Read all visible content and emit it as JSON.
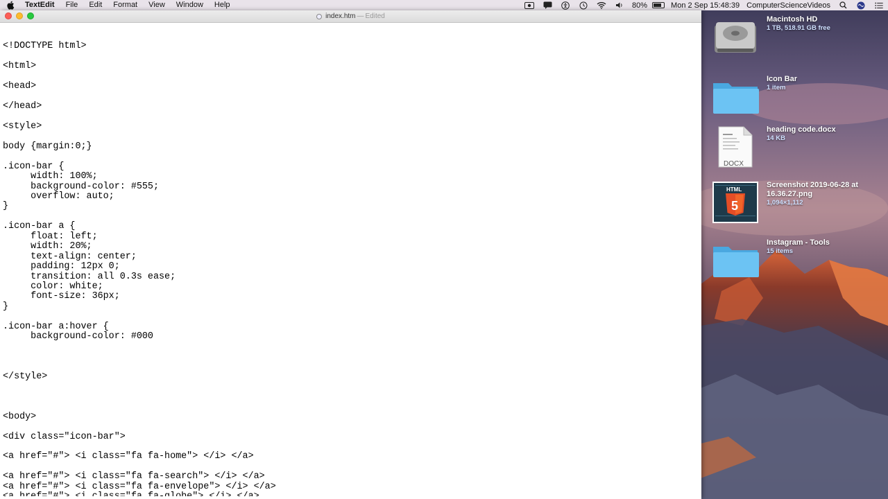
{
  "menubar": {
    "app_name": "TextEdit",
    "menus": [
      "File",
      "Edit",
      "Format",
      "View",
      "Window",
      "Help"
    ],
    "battery_percent": "80%",
    "battery_level": 0.8,
    "datetime": "Mon 2 Sep  15:48:39",
    "user": "ComputerScienceVideos"
  },
  "window": {
    "title": "index.htm",
    "separator": "—",
    "status": "Edited"
  },
  "editor": {
    "lines": [
      "",
      "<!DOCTYPE html>",
      "",
      "<html>",
      "",
      "<head>",
      "",
      "</head>",
      "",
      "<style>",
      "",
      "body {margin:0;}",
      "",
      ".icon-bar {",
      "     width: 100%;",
      "     background-color: #555;",
      "     overflow: auto;",
      "}",
      "",
      ".icon-bar a {",
      "     float: left;",
      "     width: 20%;",
      "     text-align: center;",
      "     padding: 12px 0;",
      "     transition: all 0.3s ease;",
      "     color: white;",
      "     font-size: 36px;",
      "}",
      "",
      ".icon-bar a:hover {",
      "     background-color: #000",
      "",
      "",
      "",
      "</style>",
      "",
      "",
      "",
      "<body>",
      "",
      "<div class=\"icon-bar\">",
      "",
      "<a href=\"#\"> <i class=\"fa fa-home\"> </i> </a>",
      "",
      "<a href=\"#\"> <i class=\"fa fa-search\"> </i> </a>",
      "<a href=\"#\"> <i class=\"fa fa-envelope\"> </i> </a>",
      "<a href=\"#\"> <i class=\"fa fa-globe\"> </i> </a>"
    ]
  },
  "desktop": {
    "items": [
      {
        "name": "Macintosh HD",
        "info": "1 TB, 518.91 GB free",
        "icon": "hard-drive-icon"
      },
      {
        "name": "Icon Bar",
        "info": "1 item",
        "icon": "folder-icon"
      },
      {
        "name": "heading code.docx",
        "info": "14 KB",
        "icon": "docx-file-icon"
      },
      {
        "name": "Screenshot 2019-06-28 at 16.36.27.png",
        "info": "1,094×1,112",
        "icon": "html5-screenshot-icon"
      },
      {
        "name": "Instagram - Tools",
        "info": "15 items",
        "icon": "folder-icon"
      }
    ]
  },
  "colors": {
    "menubar_bg": "#e9e3ea",
    "close": "#fc5f57",
    "minimize": "#fdbb2e",
    "zoom": "#29c940",
    "folder": "#5ab8ee"
  }
}
